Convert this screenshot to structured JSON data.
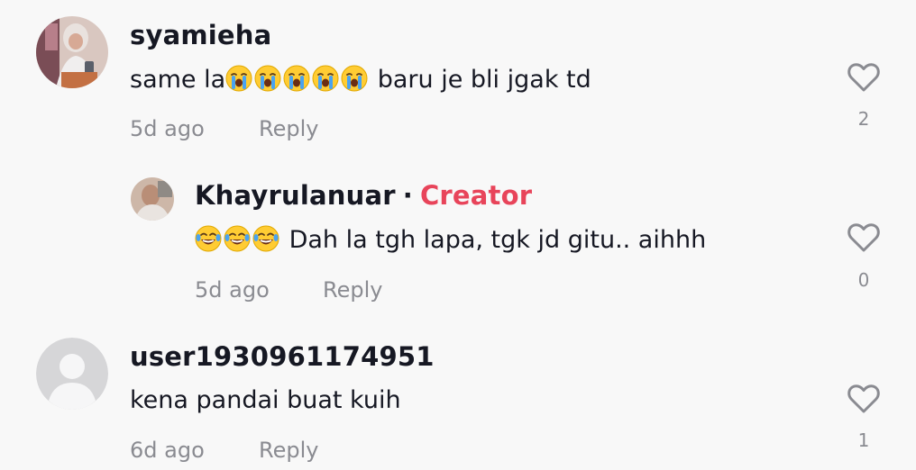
{
  "comments": [
    {
      "username": "syamieha",
      "text_before": "same la",
      "emoji_name": "loudly-crying-face-emoji",
      "emoji_count": 5,
      "text_after": " baru je bli jgak td",
      "time": "5d ago",
      "reply_label": "Reply",
      "likes": "2"
    },
    {
      "username": "Khayrulanuar",
      "separator": "·",
      "badge": "Creator",
      "emoji_name": "tears-of-joy-emoji",
      "emoji_count": 3,
      "text_after": " Dah la tgh lapa, tgk jd gitu.. aihhh",
      "time": "5d ago",
      "reply_label": "Reply",
      "likes": "0"
    },
    {
      "username": "user1930961174951",
      "text": "kena pandai buat kuih",
      "time": "6d ago",
      "reply_label": "Reply",
      "likes": "1"
    }
  ],
  "colors": {
    "background": "#f8f8f8",
    "text": "#161823",
    "muted": "#8a8b91",
    "creator_badge": "#e8445a"
  },
  "icons": {
    "like": "heart-outline-icon",
    "default_avatar": "default-user-avatar"
  }
}
